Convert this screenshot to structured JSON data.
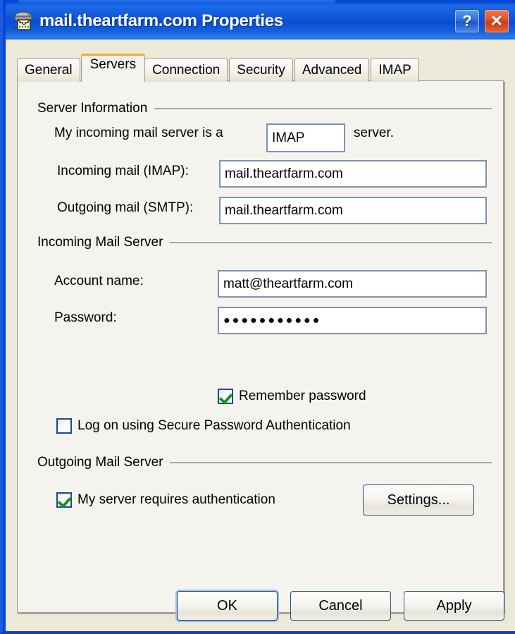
{
  "window": {
    "title": "mail.theartfarm.com Properties",
    "icon": "mail-server-icon",
    "help_label": "?",
    "close_label": "✕"
  },
  "tabs": [
    {
      "label": "General",
      "active": false
    },
    {
      "label": "Servers",
      "active": true
    },
    {
      "label": "Connection",
      "active": false
    },
    {
      "label": "Security",
      "active": false
    },
    {
      "label": "Advanced",
      "active": false
    },
    {
      "label": "IMAP",
      "active": false
    }
  ],
  "server_information": {
    "group_label": "Server Information",
    "incoming_type_prefix": "My incoming mail server is a",
    "incoming_type_value": "IMAP",
    "incoming_type_suffix": "server.",
    "incoming_label": "Incoming mail (IMAP):",
    "incoming_value": "mail.theartfarm.com",
    "outgoing_label": "Outgoing mail (SMTP):",
    "outgoing_value": "mail.theartfarm.com"
  },
  "incoming_mail_server": {
    "group_label": "Incoming Mail Server",
    "account_label": "Account name:",
    "account_value": "matt@theartfarm.com",
    "password_label": "Password:",
    "password_value": "●●●●●●●●●●●",
    "remember_password_label": "Remember password",
    "remember_password_checked": true,
    "spa_label": "Log on using Secure Password Authentication",
    "spa_checked": false
  },
  "outgoing_mail_server": {
    "group_label": "Outgoing Mail Server",
    "requires_auth_label": "My server requires authentication",
    "requires_auth_checked": true,
    "settings_label": "Settings..."
  },
  "footer": {
    "ok_label": "OK",
    "cancel_label": "Cancel",
    "apply_label": "Apply"
  },
  "colors": {
    "titlebar_blue": "#0B4CD4",
    "dialog_face": "#ECE9D8",
    "tabpage_face": "#F4F3EE",
    "active_tab_accent": "#F7A830",
    "field_border": "#7D94B0",
    "checkbox_border": "#1B4A8C",
    "check_green": "#169417",
    "group_rule": "#ACA899",
    "close_red": "#E3502A"
  }
}
